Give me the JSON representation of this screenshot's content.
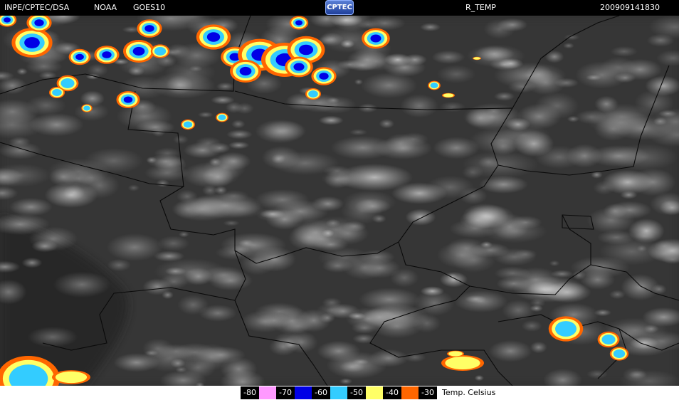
{
  "header": {
    "source": "INPE/CPTEC/DSA",
    "agency": "NOAA",
    "satellite": "GOES10",
    "logo_text": "CPTEC",
    "product": "R_TEMP",
    "timestamp": "200909141830"
  },
  "legend": {
    "title": "Temp. Celsius",
    "entries": [
      {
        "label": "-80",
        "color": "#000000"
      },
      {
        "label": "-70",
        "color": "#ff99ff"
      },
      {
        "label": "-60",
        "color": "#0000e6"
      },
      {
        "label": "-50",
        "color": "#33ccff"
      },
      {
        "label": "-40",
        "color": "#ffff66"
      },
      {
        "label": "-30",
        "color": "#ff6600"
      }
    ]
  }
}
